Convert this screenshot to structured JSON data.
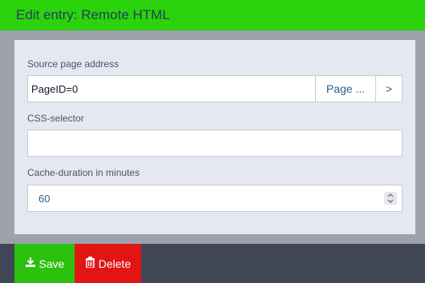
{
  "header": {
    "title": "Edit entry: Remote HTML"
  },
  "form": {
    "source": {
      "label": "Source page address",
      "value": "PageID=0",
      "browse_label": "Page ...",
      "go_label": ">"
    },
    "css_selector": {
      "label": "CSS-selector",
      "value": ""
    },
    "cache_duration": {
      "label": "Cache-duration in minutes",
      "value": "60"
    }
  },
  "footer": {
    "save_label": "Save",
    "delete_label": "Delete"
  },
  "icons": {
    "save": "download-icon",
    "delete": "trash-icon",
    "spinner": "spinner-arrows-icon"
  },
  "colors": {
    "header_bg": "#2bd30c",
    "header_text": "#23415b",
    "save_bg": "#2bc10e",
    "delete_bg": "#e21515",
    "footer_bg": "#404656"
  }
}
